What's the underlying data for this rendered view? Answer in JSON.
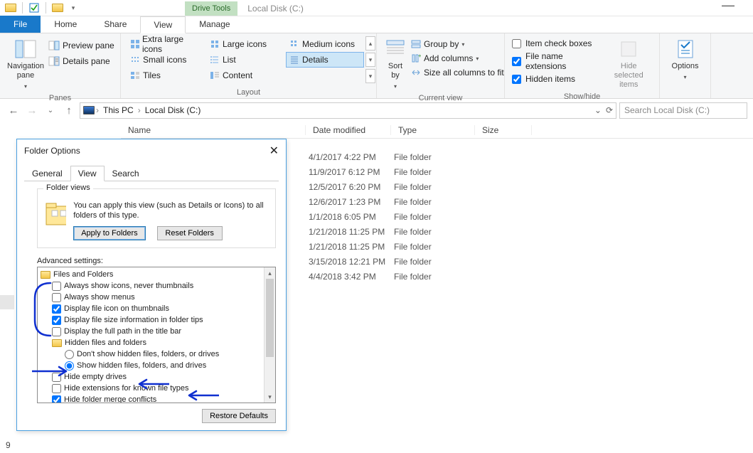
{
  "titlebar": {
    "context_tab": "Drive Tools",
    "context_title": "Local Disk (C:)"
  },
  "tabs": {
    "file": "File",
    "home": "Home",
    "share": "Share",
    "view": "View",
    "manage": "Manage"
  },
  "ribbon": {
    "panes": {
      "nav": "Navigation pane",
      "preview": "Preview pane",
      "details": "Details pane",
      "group": "Panes"
    },
    "layout": {
      "xl": "Extra large icons",
      "lg": "Large icons",
      "md": "Medium icons",
      "sm": "Small icons",
      "list": "List",
      "details": "Details",
      "tiles": "Tiles",
      "content": "Content",
      "group": "Layout"
    },
    "current": {
      "sort": "Sort by",
      "groupby": "Group by",
      "addcols": "Add columns",
      "sizeall": "Size all columns to fit",
      "group": "Current view"
    },
    "showhide": {
      "item_check": "Item check boxes",
      "file_ext": "File name extensions",
      "hidden": "Hidden items",
      "hide_sel": "Hide selected items",
      "group": "Show/hide"
    },
    "options": "Options"
  },
  "address": {
    "thispc": "This PC",
    "local": "Local Disk (C:)"
  },
  "search_placeholder": "Search Local Disk (C:)",
  "columns": {
    "name": "Name",
    "date": "Date modified",
    "type": "Type",
    "size": "Size"
  },
  "files": [
    {
      "date": "4/1/2017 4:22 PM",
      "type": "File folder"
    },
    {
      "date": "11/9/2017 6:12 PM",
      "type": "File folder"
    },
    {
      "date": "12/5/2017 6:20 PM",
      "type": "File folder"
    },
    {
      "date": "12/6/2017 1:23 PM",
      "type": "File folder"
    },
    {
      "date": "1/1/2018 6:05 PM",
      "type": "File folder"
    },
    {
      "date": "1/21/2018 11:25 PM",
      "type": "File folder"
    },
    {
      "date": "1/21/2018 11:25 PM",
      "type": "File folder"
    },
    {
      "date": "3/15/2018 12:21 PM",
      "type": "File folder"
    },
    {
      "date": "4/4/2018 3:42 PM",
      "type": "File folder"
    }
  ],
  "dialog": {
    "title": "Folder Options",
    "tabs": {
      "general": "General",
      "view": "View",
      "search": "Search"
    },
    "fv": {
      "legend": "Folder views",
      "text": "You can apply this view (such as Details or Icons) to all folders of this type.",
      "apply": "Apply to Folders",
      "reset": "Reset Folders"
    },
    "adv_label": "Advanced settings:",
    "adv": {
      "root": "Files and Folders",
      "always_icons": "Always show icons, never thumbnails",
      "always_menus": "Always show menus",
      "disp_icon_thumb": "Display file icon on thumbnails",
      "disp_size_tips": "Display file size information in folder tips",
      "full_path": "Display the full path in the title bar",
      "hidden_group": "Hidden files and folders",
      "dont_show": "Don't show hidden files, folders, or drives",
      "show_hidden": "Show hidden files, folders, and drives",
      "hide_empty": "Hide empty drives",
      "hide_ext": "Hide extensions for known file types",
      "hide_merge": "Hide folder merge conflicts"
    },
    "restore": "Restore Defaults"
  },
  "footer": "9"
}
